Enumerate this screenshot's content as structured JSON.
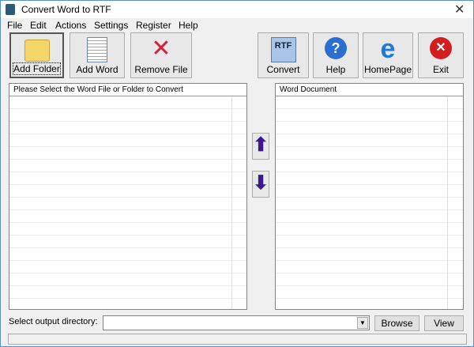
{
  "window": {
    "title": "Convert Word to RTF",
    "close": "✕"
  },
  "menu": [
    "File",
    "Edit",
    "Actions",
    "Settings",
    "Register",
    "Help"
  ],
  "toolbar": {
    "add_folder": "Add Folder",
    "add_word": "Add Word",
    "remove_file": "Remove File",
    "convert": "Convert",
    "convert_icon_text": "RTF",
    "help": "Help",
    "homepage": "HomePage",
    "exit": "Exit"
  },
  "left_list": {
    "header": "Please Select the Word File or Folder to Convert"
  },
  "right_list": {
    "header": "Word Document"
  },
  "arrows": {
    "up": "⬆",
    "down": "⬇"
  },
  "output": {
    "label": "Select  output directory:",
    "value": "",
    "browse": "Browse",
    "view": "View"
  }
}
